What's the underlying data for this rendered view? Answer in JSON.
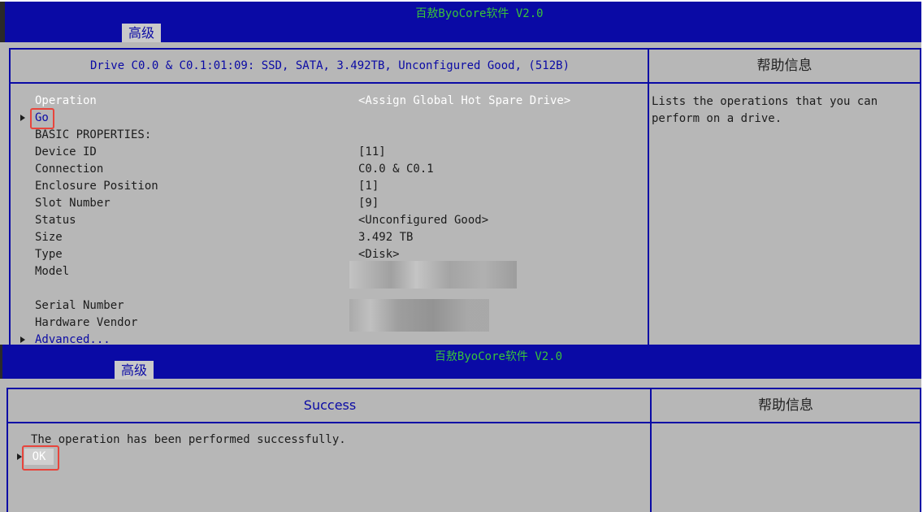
{
  "screen1": {
    "app_title": "百敖ByoCore软件 V2.0",
    "tab": "高级",
    "drive_header": "Drive C0.0 & C0.1:01:09: SSD, SATA, 3.492TB, Unconfigured Good, (512B)",
    "help_title": "帮助信息",
    "help_text": "Lists the operations that you can perform on a drive.",
    "operation": {
      "label": "Operation",
      "value": "<Assign Global Hot Spare Drive>"
    },
    "go_label": "Go",
    "basic_properties": "BASIC PROPERTIES:",
    "properties": [
      {
        "label": "Device ID",
        "value": "[11]"
      },
      {
        "label": "Connection",
        "value": "C0.0 & C0.1"
      },
      {
        "label": "Enclosure Position",
        "value": "[1]"
      },
      {
        "label": "Slot Number",
        "value": "[9]"
      },
      {
        "label": "Status",
        "value": "<Unconfigured Good>"
      },
      {
        "label": "Size",
        "value": "3.492 TB"
      },
      {
        "label": "Type",
        "value": "<Disk>"
      },
      {
        "label": "Model",
        "value": ""
      },
      {
        "label": "Serial Number",
        "value": ""
      },
      {
        "label": "Hardware Vendor",
        "value": ""
      }
    ],
    "advanced_label": "Advanced..."
  },
  "screen2": {
    "app_title": "百敖ByoCore软件 V2.0",
    "tab": "高级",
    "dialog_title": "Success",
    "help_title": "帮助信息",
    "message": "The operation has been performed successfully.",
    "ok_label": "OK"
  },
  "colors": {
    "title_bar": "#0a0aa5",
    "background": "#b7b7b7",
    "title_text": "#39c23a",
    "highlight_box": "#e8453c"
  }
}
